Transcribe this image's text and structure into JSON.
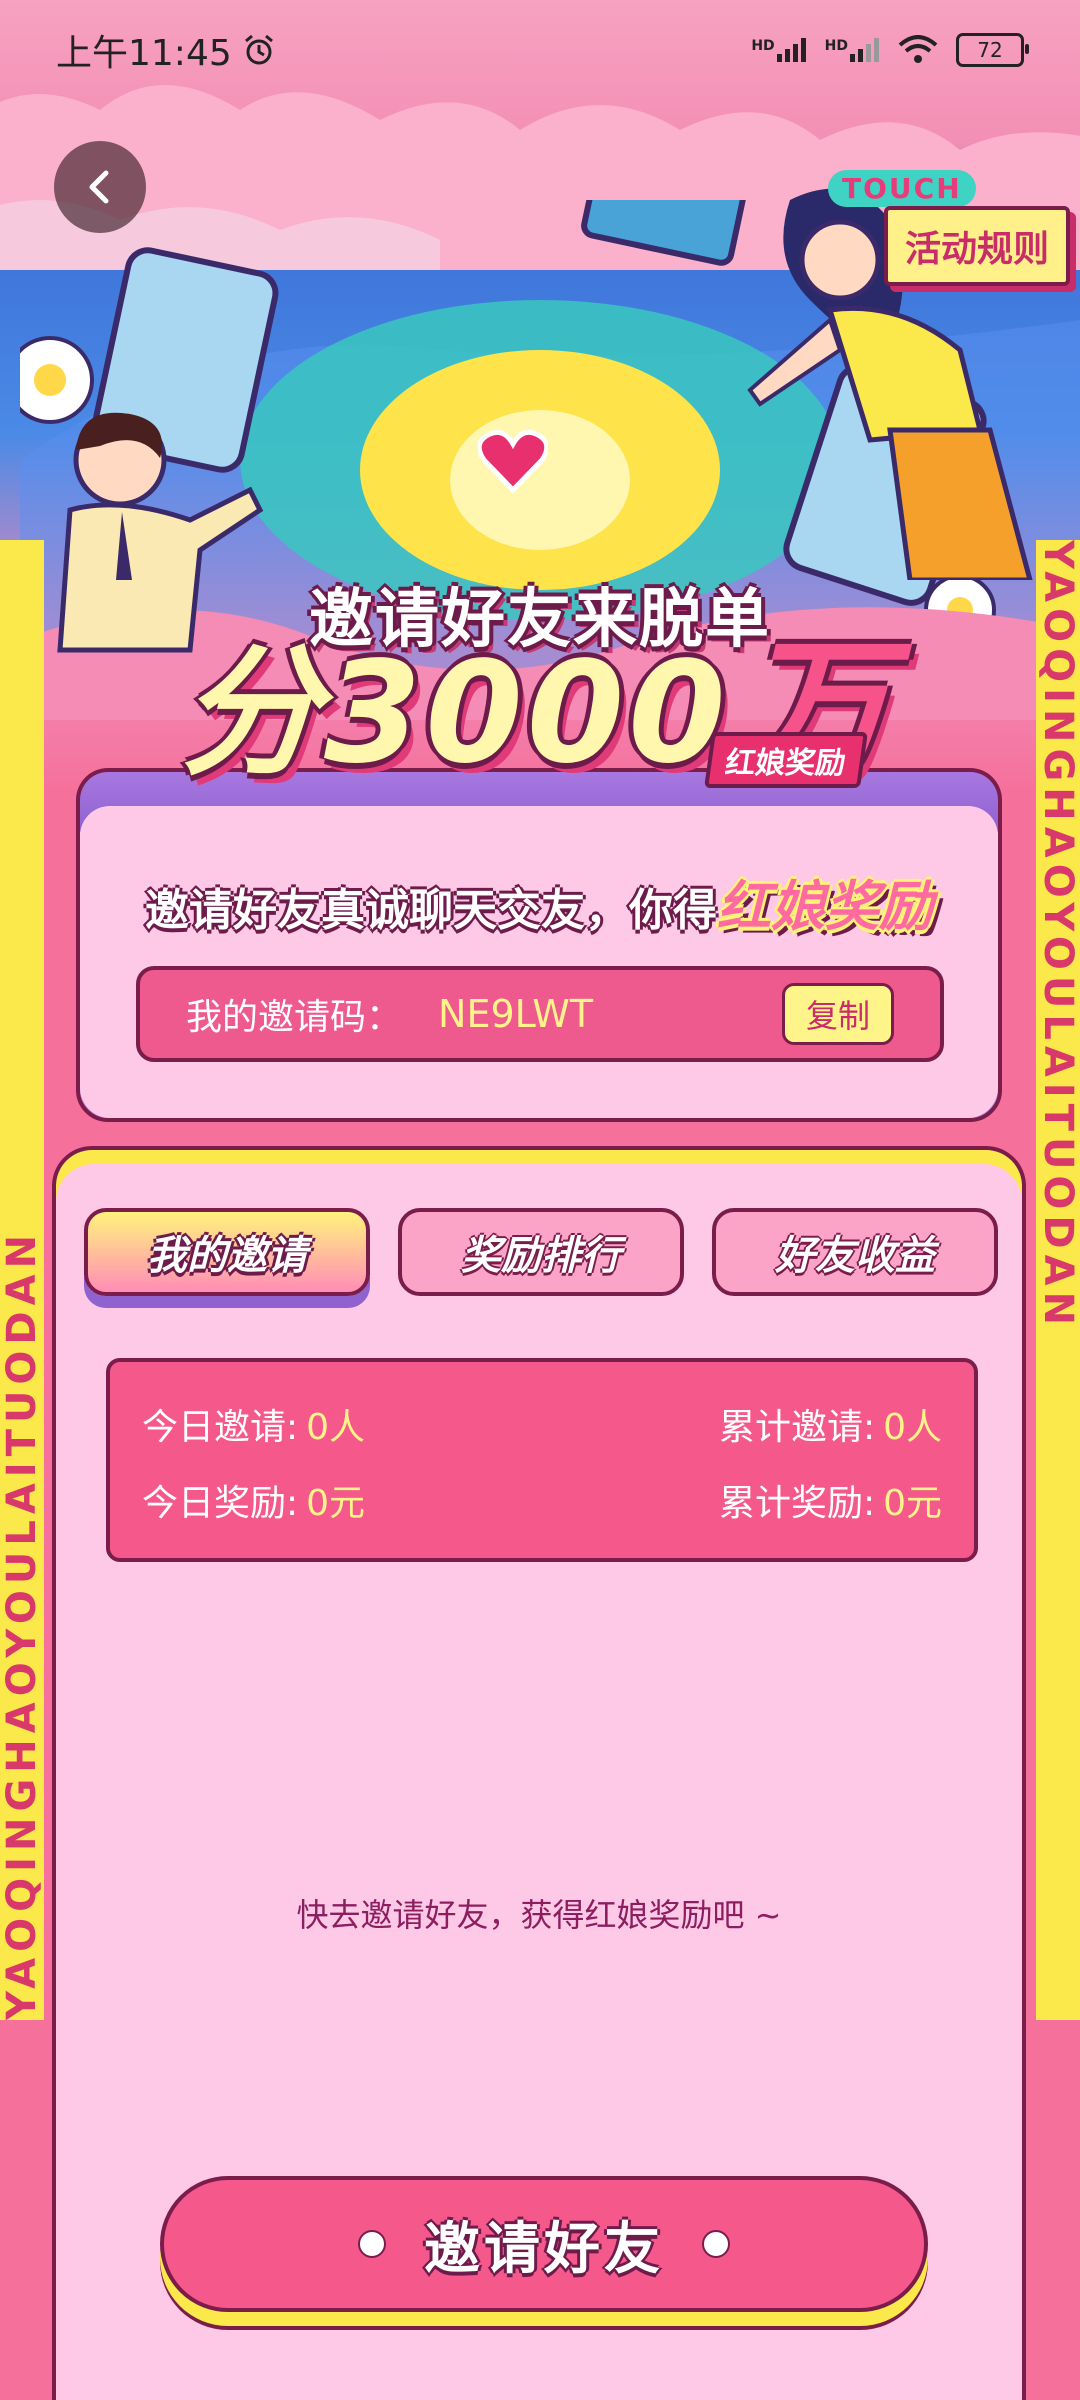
{
  "status_bar": {
    "time": "上午11:45",
    "signal_1": "HD",
    "signal_2": "HD",
    "battery": "72"
  },
  "header": {
    "touch_label": "TOUCH",
    "rules_label": "活动规则"
  },
  "hero": {
    "title_line1": "邀请好友来脱单",
    "title_line2": "分3000",
    "title_wan": "万",
    "title_badge": "红娘奖励"
  },
  "side_text": "YAOQINGHAOYOULAITUODAN",
  "invite_card": {
    "headline_main": "邀请好友真诚聊天交友，你得",
    "headline_highlight": "红娘奖励",
    "code_label": "我的邀请码：",
    "code_value": "NE9LWT",
    "copy_label": "复制"
  },
  "tabs": [
    {
      "label": "我的邀请",
      "active": true
    },
    {
      "label": "奖励排行",
      "active": false
    },
    {
      "label": "好友收益",
      "active": false
    }
  ],
  "stats": {
    "today_invites_label": "今日邀请:",
    "today_invites_value": "0人",
    "total_invites_label": "累计邀请:",
    "total_invites_value": "0人",
    "today_reward_label": "今日奖励:",
    "today_reward_value": "0元",
    "total_reward_label": "累计奖励:",
    "total_reward_value": "0元"
  },
  "empty_hint": "快去邀请好友，获得红娘奖励吧 ~",
  "invite_button_label": "邀请好友",
  "colors": {
    "background": "#f5719c",
    "card_fill": "#fec9e6",
    "accent_pink": "#f5598b",
    "outline": "#7a1d4b",
    "yellow": "#fff48a"
  }
}
